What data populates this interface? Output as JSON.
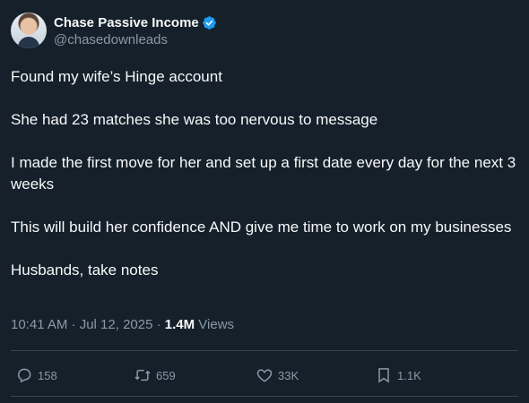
{
  "author": {
    "display_name": "Chase Passive Income",
    "handle": "@chasedownleads",
    "verified": true
  },
  "tweet": {
    "paragraphs": [
      "Found my wife’s Hinge account",
      "She had 23 matches she was too nervous to message",
      "I made the first move for her and set up a first date every day for the next 3 weeks",
      "This will build her confidence AND give me time to work on my businesses",
      "Husbands, take notes"
    ],
    "time": "10:41 AM · Jul 12, 2025 · ",
    "views_count": "1.4M",
    "views_label": " Views"
  },
  "actions": {
    "replies": "158",
    "retweets": "659",
    "likes": "33K",
    "bookmarks": "1.1K"
  },
  "colors": {
    "background": "#15202b",
    "text": "#f7f9f9",
    "secondary": "#8b98a5",
    "verified": "#1d9bf0"
  }
}
